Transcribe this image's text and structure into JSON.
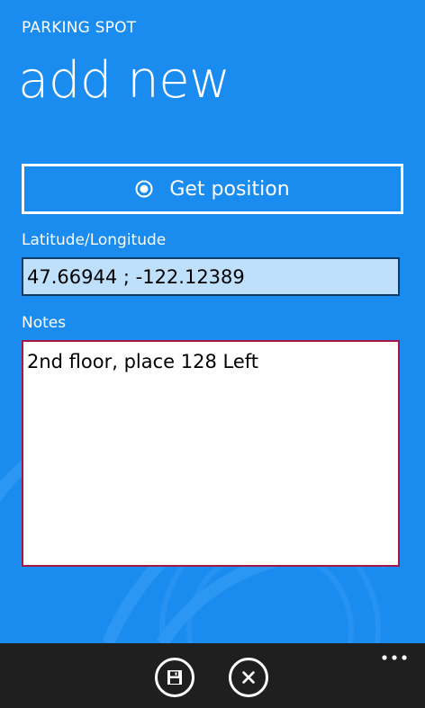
{
  "app": {
    "title": "PARKING SPOT"
  },
  "page": {
    "title": "add new"
  },
  "get_position": {
    "label": "Get position",
    "icon": "radio-icon"
  },
  "latlng": {
    "label": "Latitude/Longitude",
    "value": "47.66944 ; -122.12389"
  },
  "notes": {
    "label": "Notes",
    "value": "2nd floor, place 128 Left"
  },
  "app_bar": {
    "buttons": [
      {
        "name": "save",
        "icon": "save-icon"
      },
      {
        "name": "cancel",
        "icon": "close-icon"
      }
    ],
    "more_icon": "ellipsis-icon"
  },
  "colors": {
    "background": "#1a8cf0",
    "app_bar": "#1f1f1f",
    "latlng_input_bg": "#bfe0fb",
    "notes_border": "#a2184a"
  }
}
